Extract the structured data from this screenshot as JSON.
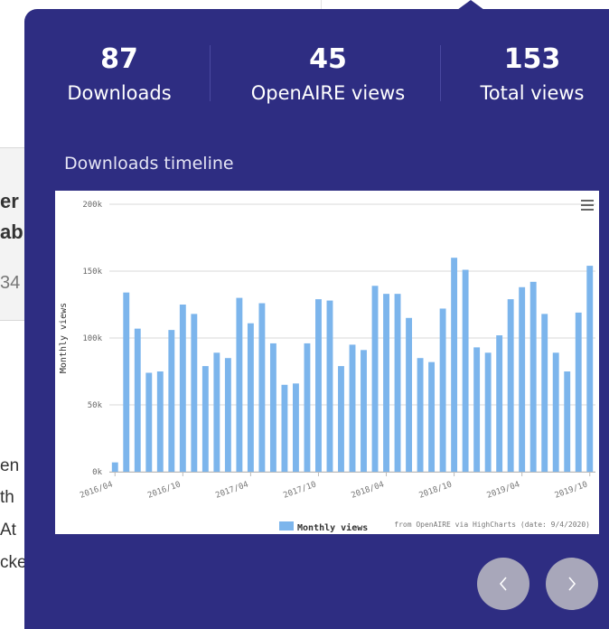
{
  "background": {
    "fragments": [
      "er",
      "ab",
      "34",
      "en",
      "th",
      "At",
      "cke"
    ]
  },
  "stats": [
    {
      "value": "87",
      "label": "Downloads"
    },
    {
      "value": "45",
      "label": "OpenAIRE views"
    },
    {
      "value": "153",
      "label": "Total views"
    }
  ],
  "timeline_title": "Downloads timeline",
  "chart_data": {
    "type": "bar",
    "ylabel": "Monthly views",
    "ylim": [
      0,
      200000
    ],
    "y_ticks": [
      "0k",
      "50k",
      "100k",
      "150k",
      "200k"
    ],
    "x_tick_labels": [
      "2016/04",
      "2016/10",
      "2017/04",
      "2017/10",
      "2018/04",
      "2018/10",
      "2019/04",
      "2019/10"
    ],
    "legend": "Monthly views",
    "credit": "from OpenAIRE via HighCharts (date: 9/4/2020)",
    "color": "#7cb5ec",
    "series": [
      {
        "name": "Monthly views",
        "values": [
          7000,
          134000,
          107000,
          74000,
          75000,
          106000,
          125000,
          118000,
          79000,
          89000,
          85000,
          130000,
          111000,
          126000,
          96000,
          65000,
          66000,
          96000,
          129000,
          128000,
          79000,
          95000,
          91000,
          139000,
          133000,
          133000,
          115000,
          85000,
          82000,
          122000,
          160000,
          151000,
          93000,
          89000,
          102000,
          129000,
          138000,
          142000,
          118000,
          89000,
          75000,
          119000,
          154000
        ]
      }
    ]
  },
  "nav": {
    "prev": "‹",
    "next": "›"
  },
  "icons": {
    "menu": "hamburger-menu-icon",
    "prev": "chevron-left-icon",
    "next": "chevron-right-icon"
  }
}
